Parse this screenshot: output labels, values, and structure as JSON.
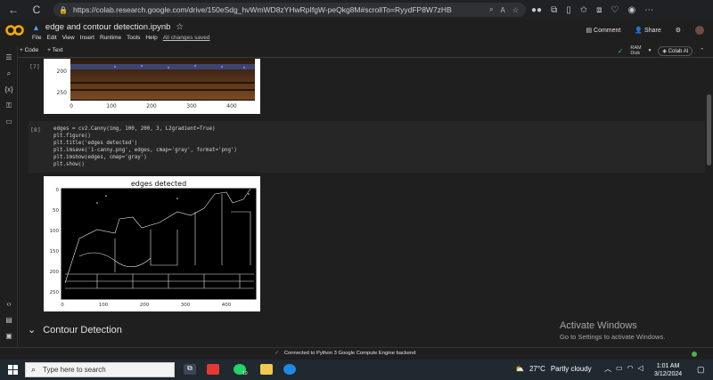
{
  "browser": {
    "url": "https://colab.research.google.com/drive/150eSdg_hvWmWD8zYHwRpIfgW-peQkg8M#scrollTo=RyydFP8W7zHB",
    "back": "←",
    "refresh": "C",
    "home": "⌂"
  },
  "colab": {
    "logo_text": "CO",
    "notebook_title": "edge and contour detection.ipynb",
    "menus": [
      "File",
      "Edit",
      "View",
      "Insert",
      "Runtime",
      "Tools",
      "Help"
    ],
    "saved_status": "All changes saved",
    "comment_label": "Comment",
    "share_label": "Share"
  },
  "toolbar": {
    "code_label": "+ Code",
    "text_label": "+ Text",
    "ram_label": "RAM",
    "disk_label": "Disk",
    "colab_ai_label": "Colab AI"
  },
  "cells": {
    "prev_exec_count": "[7]",
    "top_image": {
      "y_ticks": [
        "200",
        "250"
      ],
      "x_ticks": [
        "0",
        "100",
        "200",
        "300",
        "400"
      ]
    },
    "code_exec_count": "[8]",
    "code_lines": [
      "edges = cv2.Canny(img, 100, 200, 3, L2gradient=True)",
      "plt.figure()",
      "plt.title('edges detected')",
      "plt.imsave('1-canny.png', edges, cmap='gray', format='png')",
      "plt.imshow(edges, cmap='gray')",
      "plt.show()"
    ],
    "edges_plot": {
      "title": "edges detected",
      "y_ticks": [
        "0",
        "50",
        "100",
        "150",
        "200",
        "250"
      ],
      "x_ticks": [
        "0",
        "100",
        "200",
        "300",
        "400"
      ]
    },
    "section_heading": "Contour Detection"
  },
  "watermark": {
    "line1": "Activate Windows",
    "line2": "Go to Settings to activate Windows."
  },
  "statusbar": {
    "check": "✓",
    "text": "Connected to Python 3 Google Compute Engine backend"
  },
  "taskbar": {
    "search_placeholder": "Type here to search",
    "temperature": "27°C",
    "weather": "Partly cloudy",
    "time": "1:01 AM",
    "date": "3/12/2024",
    "badge": "10"
  }
}
